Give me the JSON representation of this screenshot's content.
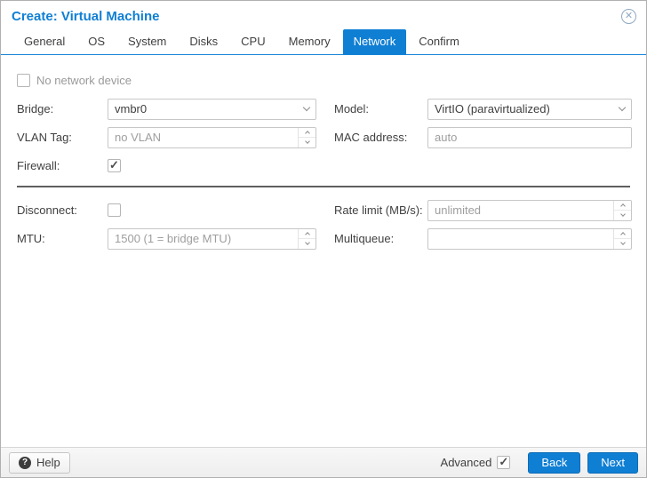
{
  "window": {
    "title": "Create: Virtual Machine"
  },
  "icons": {
    "close": "circle-x",
    "help": "question-mark-circle",
    "combo_trigger": "chevron-down",
    "spinner_trigger": "chevron-up-down"
  },
  "tabs": [
    {
      "label": "General",
      "active": false
    },
    {
      "label": "OS",
      "active": false
    },
    {
      "label": "System",
      "active": false
    },
    {
      "label": "Disks",
      "active": false
    },
    {
      "label": "CPU",
      "active": false
    },
    {
      "label": "Memory",
      "active": false
    },
    {
      "label": "Network",
      "active": true
    },
    {
      "label": "Confirm",
      "active": false
    }
  ],
  "form": {
    "no_network_device": {
      "label": "No network device",
      "checked": false
    },
    "bridge": {
      "label": "Bridge:",
      "value": "vmbr0"
    },
    "model": {
      "label": "Model:",
      "value": "VirtIO (paravirtualized)"
    },
    "vlan_tag": {
      "label": "VLAN Tag:",
      "placeholder": "no VLAN"
    },
    "mac_address": {
      "label": "MAC address:",
      "placeholder": "auto"
    },
    "firewall": {
      "label": "Firewall:",
      "checked": true
    },
    "disconnect": {
      "label": "Disconnect:",
      "checked": false
    },
    "rate_limit": {
      "label": "Rate limit (MB/s):",
      "placeholder": "unlimited"
    },
    "mtu": {
      "label": "MTU:",
      "placeholder": "1500 (1 = bridge MTU)"
    },
    "multiqueue": {
      "label": "Multiqueue:",
      "placeholder": ""
    }
  },
  "footer": {
    "help_label": "Help",
    "advanced_label": "Advanced",
    "advanced_checked": true,
    "back_label": "Back",
    "next_label": "Next"
  },
  "colors": {
    "accent": "#0f7fd4",
    "tab_active_bg": "#0f7fd4",
    "button_bg": "#0f7fd4",
    "placeholder_text": "#9e9e9e",
    "divider": "#5f5f5f"
  }
}
